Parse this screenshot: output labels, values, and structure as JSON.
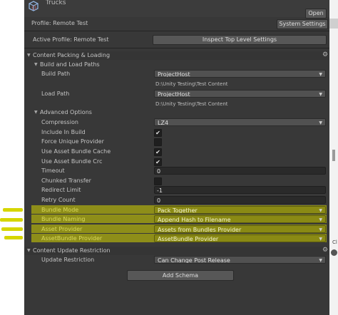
{
  "window": {
    "title": "Trucks",
    "open_label": "Open"
  },
  "profile_bar": {
    "profile_label": "Profile: Remote Test",
    "system_settings_label": "System Settings"
  },
  "active_profile": {
    "label": "Active Profile: Remote Test",
    "inspect_button_label": "Inspect Top Level Settings"
  },
  "content_packing": {
    "section_label": "Content Packing & Loading",
    "build_load_label": "Build and Load Paths",
    "build_path": {
      "label": "Build Path",
      "value": "ProjectHost",
      "resolved": "D:\\Unity Testing\\Test Content"
    },
    "load_path": {
      "label": "Load Path",
      "value": "ProjectHost",
      "resolved": "D:\\Unity Testing\\Test Content"
    },
    "advanced_label": "Advanced Options",
    "compression": {
      "label": "Compression",
      "value": "LZ4"
    },
    "include_in_build": {
      "label": "Include In Build",
      "checked": true,
      "check": "✔"
    },
    "force_unique_provider": {
      "label": "Force Unique Provider",
      "checked": false,
      "check": ""
    },
    "use_asset_bundle_cache": {
      "label": "Use Asset Bundle Cache",
      "checked": true,
      "check": "✔"
    },
    "use_asset_bundle_crc": {
      "label": "Use Asset Bundle Crc",
      "checked": true,
      "check": "✔"
    },
    "timeout": {
      "label": "Timeout",
      "value": "0"
    },
    "chunked_transfer": {
      "label": "Chunked Transfer",
      "checked": false,
      "check": ""
    },
    "redirect_limit": {
      "label": "Redirect Limit",
      "value": "-1"
    },
    "retry_count": {
      "label": "Retry Count",
      "value": "0"
    },
    "bundle_mode": {
      "label": "Bundle Mode",
      "value": "Pack Together"
    },
    "bundle_naming": {
      "label": "Bundle Naming",
      "value": "Append Hash to Filename"
    },
    "asset_provider": {
      "label": "Asset Provider",
      "value": "Assets from Bundles Provider"
    },
    "assetbundle_provider": {
      "label": "AssetBundle Provider",
      "value": "AssetBundle Provider"
    }
  },
  "content_update": {
    "section_label": "Content Update Restriction",
    "update_restriction": {
      "label": "Update Restriction",
      "value": "Can Change Post Release"
    }
  },
  "add_schema_label": "Add Schema",
  "right_edge": {
    "text": "Cl"
  },
  "icons": {
    "asset_group": "asset-group-icon",
    "settings": "gear-icon",
    "foldout": "triangle-icon",
    "dropdown": "chevron-down-icon"
  },
  "colors": {
    "panel": "#383838",
    "highlight": "#d6d600",
    "window_bg": "#ffffff"
  }
}
